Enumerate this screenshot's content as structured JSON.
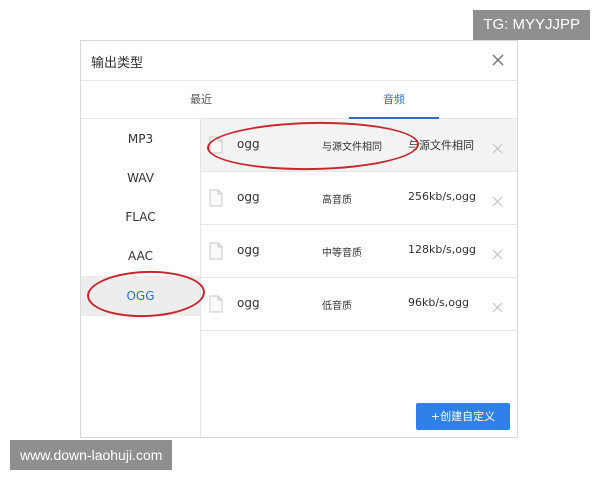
{
  "dialog": {
    "title": "输出类型"
  },
  "tabs": [
    {
      "label": "最近"
    },
    {
      "label": "音频"
    }
  ],
  "sidebar": {
    "formats": [
      {
        "label": "MP3"
      },
      {
        "label": "WAV"
      },
      {
        "label": "FLAC"
      },
      {
        "label": "AAC"
      },
      {
        "label": "OGG"
      }
    ],
    "selected": "OGG"
  },
  "presets": [
    {
      "name": "ogg",
      "quality": "与源文件相同",
      "spec": "与源文件相同"
    },
    {
      "name": "ogg",
      "quality": "高音质",
      "spec": "256kb/s,ogg"
    },
    {
      "name": "ogg",
      "quality": "中等音质",
      "spec": "128kb/s,ogg"
    },
    {
      "name": "ogg",
      "quality": "低音质",
      "spec": "96kb/s,ogg"
    }
  ],
  "actions": {
    "create_custom": "+创建自定义"
  },
  "watermarks": {
    "top": "TG: MYYJJPP",
    "bottom": "www.down-laohuji.com"
  },
  "colors": {
    "accent": "#2d6fbf",
    "button": "#2f80e8",
    "annotation": "#c9262c"
  },
  "icons": {
    "close": "close-icon",
    "file": "file-icon",
    "remove": "remove-icon"
  }
}
